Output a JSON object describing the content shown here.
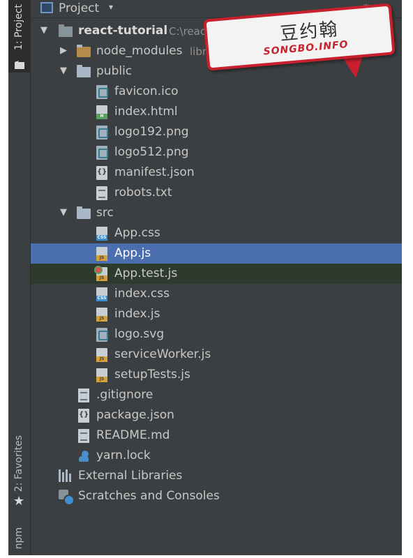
{
  "side_tabs": {
    "project": "1: Project",
    "favorites": "2: Favorites",
    "npm": "npm"
  },
  "header": {
    "title": "Project",
    "caret": "▾"
  },
  "watermark": {
    "cn_text": "豆约翰",
    "en_text": "SONGBO.INFO"
  },
  "tree": {
    "root": {
      "name": "react-tutorial",
      "path": "C:\\react-tutorial"
    },
    "node_modules": {
      "name": "node_modules",
      "hint": "library root"
    },
    "public": {
      "name": "public",
      "files": [
        "favicon.ico",
        "index.html",
        "logo192.png",
        "logo512.png",
        "manifest.json",
        "robots.txt"
      ]
    },
    "src": {
      "name": "src",
      "files": [
        "App.css",
        "App.js",
        "App.test.js",
        "index.css",
        "index.js",
        "logo.svg",
        "serviceWorker.js",
        "setupTests.js"
      ]
    },
    "root_files": [
      ".gitignore",
      "package.json",
      "README.md",
      "yarn.lock"
    ],
    "external_libraries": "External Libraries",
    "scratches": "Scratches and Consoles"
  },
  "icon_tags": {
    "html": "H",
    "css": "CSS",
    "js": "JS"
  },
  "colors": {
    "panel_bg": "#3c3f41",
    "selection": "#4b6eaf",
    "text": "#c8c8c8",
    "watermark_red": "#c8202c"
  }
}
